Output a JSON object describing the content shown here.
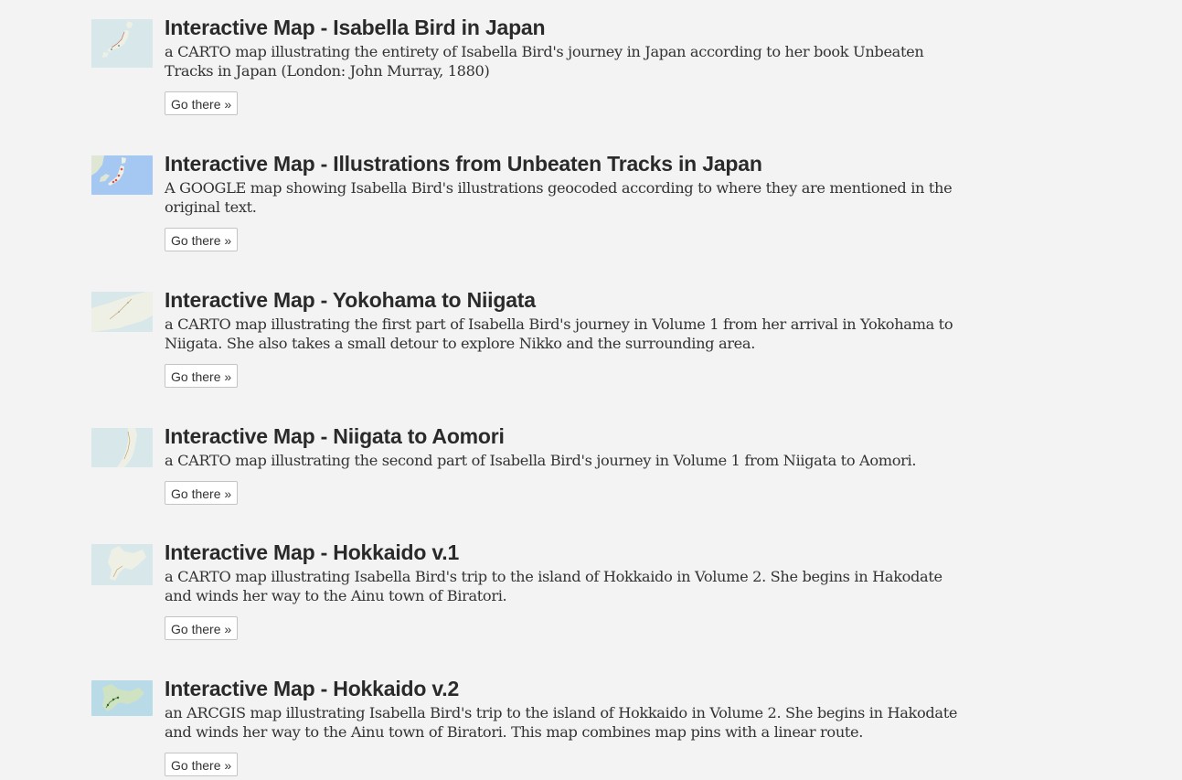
{
  "button_label": "Go there »",
  "items": [
    {
      "title": "Interactive Map - Isabella Bird in Japan",
      "description": "a CARTO map illustrating the entirety of Isabella Bird's journey in Japan according to her book Unbeaten Tracks in Japan (London: John Murray, 1880)",
      "thumbnail_icon": "japan-map-thumbnail"
    },
    {
      "title": "Interactive Map - Illustrations from Unbeaten Tracks in Japan",
      "description": "A GOOGLE map showing Isabella Bird's illustrations geocoded according to where they are mentioned in the original text.",
      "thumbnail_icon": "japan-google-map-thumbnail"
    },
    {
      "title": "Interactive Map - Yokohama to Niigata",
      "description": "a CARTO map illustrating the first part of Isabella Bird's journey in Volume 1 from her arrival in Yokohama to Niigata. She also takes a small detour to explore Nikko and the surrounding area.",
      "thumbnail_icon": "yokohama-niigata-map-thumbnail"
    },
    {
      "title": "Interactive Map - Niigata to Aomori",
      "description": "a CARTO map illustrating the second part of Isabella Bird's journey in Volume 1 from Niigata to Aomori.",
      "thumbnail_icon": "niigata-aomori-map-thumbnail"
    },
    {
      "title": "Interactive Map - Hokkaido v.1",
      "description": "a CARTO map illustrating Isabella Bird's trip to the island of Hokkaido in Volume 2. She begins in Hakodate and winds her way to the Ainu town of Biratori.",
      "thumbnail_icon": "hokkaido-map-thumbnail"
    },
    {
      "title": "Interactive Map - Hokkaido v.2",
      "description": "an ARCGIS map illustrating Isabella Bird's trip to the island of Hokkaido in Volume 2. She begins in Hakodate and winds her way to the Ainu town of Biratori. This map combines map pins with a linear route.",
      "thumbnail_icon": "hokkaido-arcgis-map-thumbnail"
    }
  ]
}
